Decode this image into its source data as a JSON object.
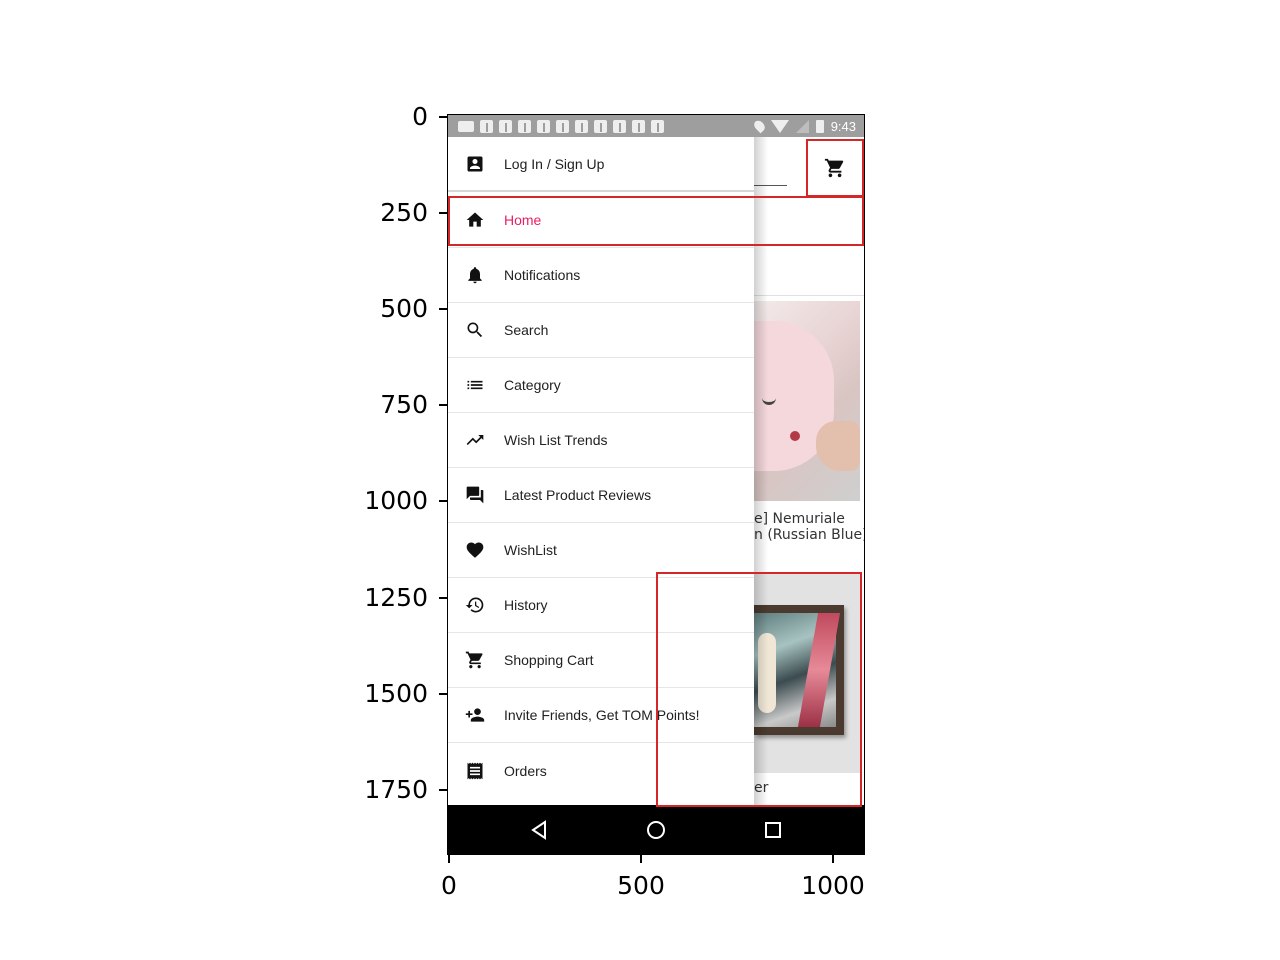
{
  "axes": {
    "y_ticks": [
      "0",
      "250",
      "500",
      "750",
      "1000",
      "1250",
      "1500",
      "1750"
    ],
    "x_ticks": [
      "0",
      "500",
      "1000"
    ]
  },
  "status_bar": {
    "time": "9:43",
    "notification_icons": [
      "message-icon",
      "facebook-icon",
      "facebook-icon",
      "facebook-icon",
      "facebook-icon",
      "facebook-icon",
      "facebook-icon",
      "facebook-icon",
      "facebook-icon",
      "facebook-icon",
      "facebook-icon"
    ],
    "system_icons": [
      "location-icon",
      "wifi-icon",
      "signal-icon",
      "battery-icon"
    ]
  },
  "drawer": {
    "items": [
      {
        "label": "Log In / Sign Up",
        "icon": "account-box-icon"
      },
      {
        "label": "Home",
        "icon": "home-icon",
        "active": true
      },
      {
        "label": "Notifications",
        "icon": "bell-icon"
      },
      {
        "label": "Search",
        "icon": "search-icon"
      },
      {
        "label": "Category",
        "icon": "list-icon"
      },
      {
        "label": "Wish List Trends",
        "icon": "trending-up-icon"
      },
      {
        "label": "Latest Product Reviews",
        "icon": "forum-icon"
      },
      {
        "label": "WishList",
        "icon": "heart-icon"
      },
      {
        "label": "History",
        "icon": "history-icon"
      },
      {
        "label": "Shopping Cart",
        "icon": "cart-icon"
      },
      {
        "label": "Invite Friends, Get TOM Points!",
        "icon": "person-add-icon"
      },
      {
        "label": "Orders",
        "icon": "receipt-icon"
      }
    ],
    "active_color": "#e91e63"
  },
  "background": {
    "product_1_caption_line1": "e] Nemuriale",
    "product_1_caption_line2": "n (Russian Blue)",
    "product_2_caption": "er"
  },
  "nav_bar": {
    "buttons": [
      "back-icon",
      "home-circle-icon",
      "recents-icon"
    ]
  },
  "highlight_color": "#d62728"
}
